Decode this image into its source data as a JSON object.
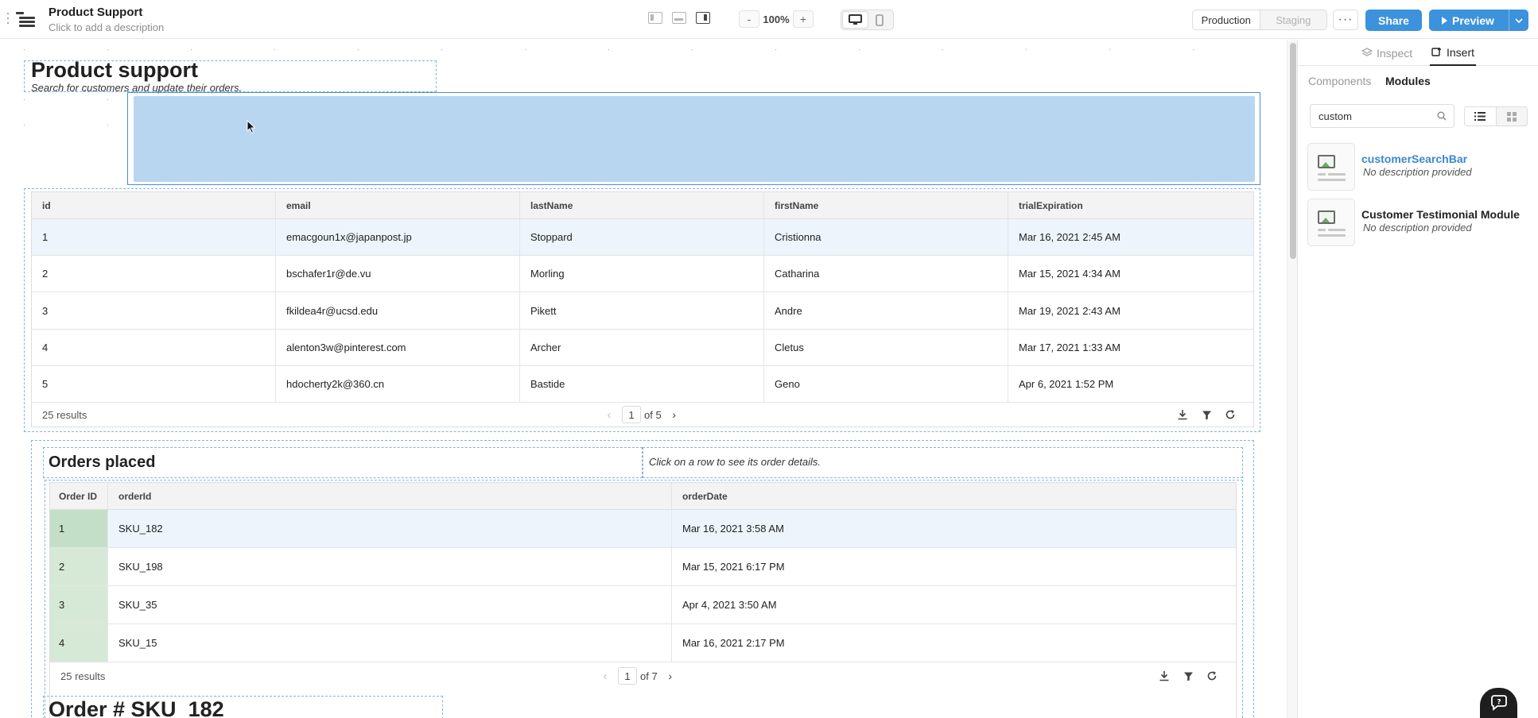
{
  "app": {
    "title": "Product Support",
    "description_placeholder": "Click to add a description",
    "zoom_minus": "-",
    "zoom_level": "100%",
    "zoom_plus": "+",
    "env_production": "Production",
    "env_staging": "Staging",
    "more_label": "···",
    "share_label": "Share",
    "preview_label": "Preview"
  },
  "page": {
    "heading": "Product support",
    "subheading": "Search for customers and update their orders."
  },
  "customers_table": {
    "columns": [
      "id",
      "email",
      "lastName",
      "firstName",
      "trialExpiration"
    ],
    "rows": [
      [
        "1",
        "emacgoun1x@japanpost.jp",
        "Stoppard",
        "Cristionna",
        "Mar 16, 2021 2:45 AM"
      ],
      [
        "2",
        "bschafer1r@de.vu",
        "Morling",
        "Catharina",
        "Mar 15, 2021 4:34 AM"
      ],
      [
        "3",
        "fkildea4r@ucsd.edu",
        "Pikett",
        "Andre",
        "Mar 19, 2021 2:43 AM"
      ],
      [
        "4",
        "alenton3w@pinterest.com",
        "Archer",
        "Cletus",
        "Mar 17, 2021 1:33 AM"
      ],
      [
        "5",
        "hdocherty2k@360.cn",
        "Bastide",
        "Geno",
        "Apr 6, 2021 1:52 PM"
      ]
    ],
    "results": "25 results",
    "page": "1",
    "of_pages": "of 5"
  },
  "orders": {
    "title": "Orders placed",
    "hint": "Click on a row to see its order details.",
    "columns": [
      "Order ID",
      "orderId",
      "orderDate"
    ],
    "rows": [
      [
        "1",
        "SKU_182",
        "Mar 16, 2021 3:58 AM"
      ],
      [
        "2",
        "SKU_198",
        "Mar 15, 2021 6:17 PM"
      ],
      [
        "3",
        "SKU_35",
        "Apr 4, 2021 3:50 AM"
      ],
      [
        "4",
        "SKU_15",
        "Mar 16, 2021 2:17 PM"
      ]
    ],
    "results": "25 results",
    "page": "1",
    "of_pages": "of 7"
  },
  "order_detail": {
    "title": "Order # SKU_182"
  },
  "panel": {
    "tab_inspect": "Inspect",
    "tab_insert": "Insert",
    "sub_components": "Components",
    "sub_modules": "Modules",
    "search_value": "custom",
    "modules": [
      {
        "name": "customerSearchBar",
        "description": "No description provided"
      },
      {
        "name": "Customer Testimonial Module",
        "description": "No description provided"
      }
    ]
  },
  "colors": {
    "accent": "#3c92dc",
    "selection": "#b9d6f1",
    "link": "#3c86d2"
  }
}
